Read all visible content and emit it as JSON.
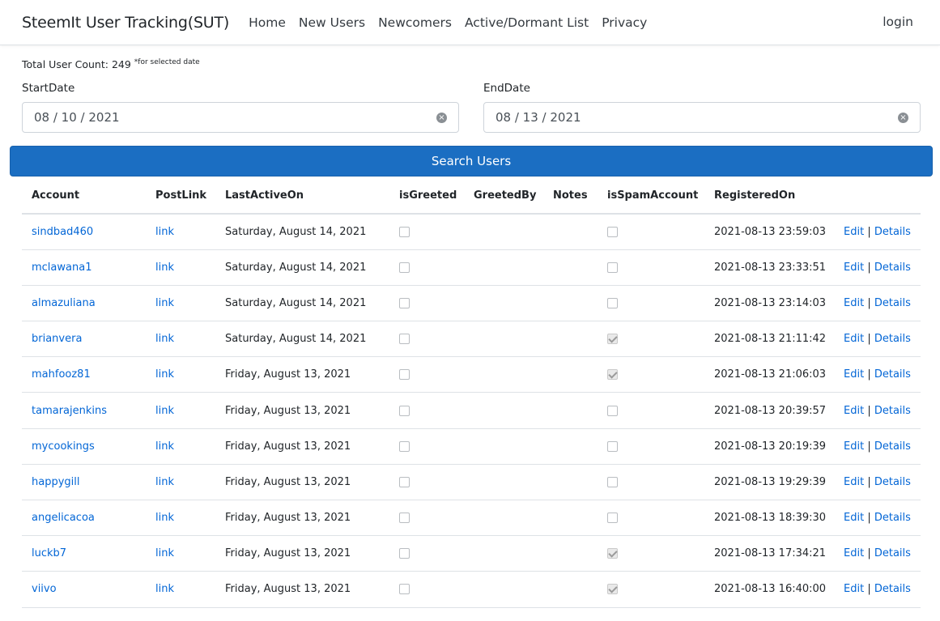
{
  "nav": {
    "brand": "SteemIt User Tracking(SUT)",
    "links": [
      "Home",
      "New Users",
      "Newcomers",
      "Active/Dormant List",
      "Privacy"
    ],
    "login": "login"
  },
  "summary": {
    "label": "Total User Count: 249",
    "note": "*for selected date"
  },
  "start_date": {
    "label": "StartDate",
    "value": "08 / 10 / 2021"
  },
  "end_date": {
    "label": "EndDate",
    "value": "08 / 13 / 2021"
  },
  "search_button": "Search Users",
  "table": {
    "headers": [
      "Account",
      "PostLink",
      "LastActiveOn",
      "isGreeted",
      "GreetedBy",
      "Notes",
      "isSpamAccount",
      "RegisteredOn",
      ""
    ],
    "edit_label": "Edit",
    "details_label": "Details",
    "separator": "|",
    "rows": [
      {
        "account": "sindbad460",
        "postlink": "link",
        "last_active": "Saturday, August 14, 2021",
        "greeted": false,
        "greeted_by": "",
        "notes": "",
        "spam": false,
        "registered": "2021-08-13 23:59:03"
      },
      {
        "account": "mclawana1",
        "postlink": "link",
        "last_active": "Saturday, August 14, 2021",
        "greeted": false,
        "greeted_by": "",
        "notes": "",
        "spam": false,
        "registered": "2021-08-13 23:33:51"
      },
      {
        "account": "almazuliana",
        "postlink": "link",
        "last_active": "Saturday, August 14, 2021",
        "greeted": false,
        "greeted_by": "",
        "notes": "",
        "spam": false,
        "registered": "2021-08-13 23:14:03"
      },
      {
        "account": "brianvera",
        "postlink": "link",
        "last_active": "Saturday, August 14, 2021",
        "greeted": false,
        "greeted_by": "",
        "notes": "",
        "spam": true,
        "registered": "2021-08-13 21:11:42"
      },
      {
        "account": "mahfooz81",
        "postlink": "link",
        "last_active": "Friday, August 13, 2021",
        "greeted": false,
        "greeted_by": "",
        "notes": "",
        "spam": true,
        "registered": "2021-08-13 21:06:03"
      },
      {
        "account": "tamarajenkins",
        "postlink": "link",
        "last_active": "Friday, August 13, 2021",
        "greeted": false,
        "greeted_by": "",
        "notes": "",
        "spam": false,
        "registered": "2021-08-13 20:39:57"
      },
      {
        "account": "mycookings",
        "postlink": "link",
        "last_active": "Friday, August 13, 2021",
        "greeted": false,
        "greeted_by": "",
        "notes": "",
        "spam": false,
        "registered": "2021-08-13 20:19:39"
      },
      {
        "account": "happygill",
        "postlink": "link",
        "last_active": "Friday, August 13, 2021",
        "greeted": false,
        "greeted_by": "",
        "notes": "",
        "spam": false,
        "registered": "2021-08-13 19:29:39"
      },
      {
        "account": "angelicacoa",
        "postlink": "link",
        "last_active": "Friday, August 13, 2021",
        "greeted": false,
        "greeted_by": "",
        "notes": "",
        "spam": false,
        "registered": "2021-08-13 18:39:30"
      },
      {
        "account": "luckb7",
        "postlink": "link",
        "last_active": "Friday, August 13, 2021",
        "greeted": false,
        "greeted_by": "",
        "notes": "",
        "spam": true,
        "registered": "2021-08-13 17:34:21"
      },
      {
        "account": "viivo",
        "postlink": "link",
        "last_active": "Friday, August 13, 2021",
        "greeted": false,
        "greeted_by": "",
        "notes": "",
        "spam": true,
        "registered": "2021-08-13 16:40:00"
      }
    ]
  },
  "colors": {
    "link": "#0366d6",
    "button": "#1b6ec2"
  }
}
